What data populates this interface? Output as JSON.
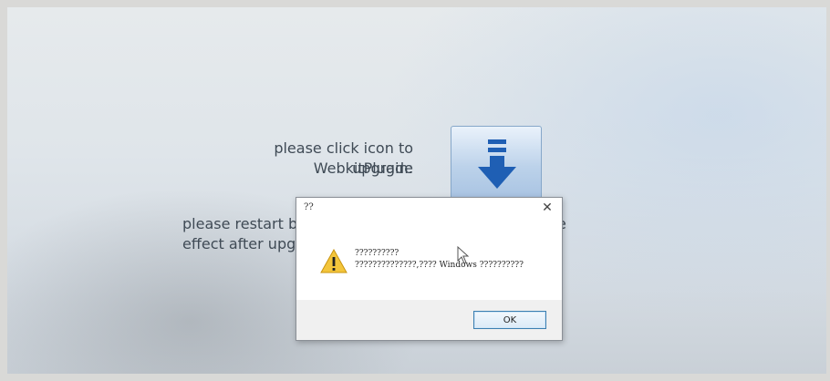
{
  "page": {
    "upgrade_prompt_line1": "please click icon to upgrade",
    "upgrade_prompt_line2": "WebkitPlugin:",
    "restart_line1": "please restart br",
    "restart_line2": "effect after upgr",
    "restart_line1_tail": "e"
  },
  "upgrade_button": {
    "icon": "download-arrow-icon",
    "color": "#1f5fb4"
  },
  "dialog": {
    "title": "??",
    "close_glyph": "✕",
    "icon": "warning-icon",
    "message_line1": "??????????",
    "message_line2": "??????????????,???? Windows ??????????",
    "ok_label": "OK"
  },
  "colors": {
    "warning_yellow": "#f3c53b",
    "ok_border": "#3c7fb1"
  }
}
